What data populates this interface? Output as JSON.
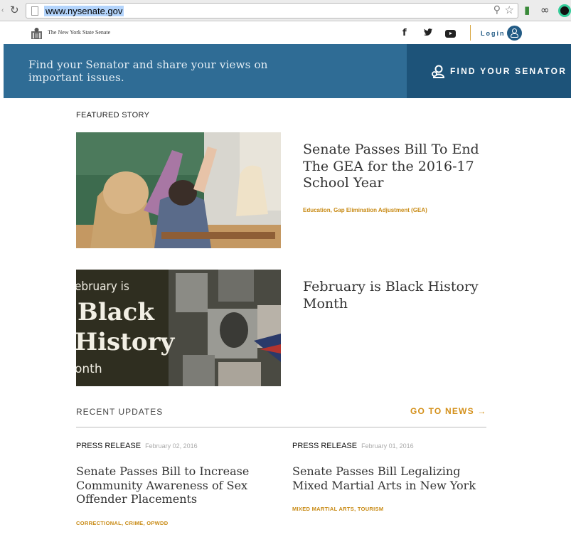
{
  "browser": {
    "url": "www.nysenate.gov",
    "icons": [
      "back-icon",
      "reload-icon",
      "page-icon",
      "zoom-icon",
      "bookmark-star-icon",
      "extension-icon",
      "extension-icon",
      "extension-icon"
    ]
  },
  "header": {
    "site_name": "The New York State Senate",
    "social": [
      "facebook-icon",
      "twitter-icon",
      "youtube-icon"
    ],
    "login_label": "Login"
  },
  "banner": {
    "text": "Find your Senator and share your views on important issues.",
    "button_label": "FIND YOUR SENATOR"
  },
  "featured": {
    "label": "FEATURED STORY",
    "stories": [
      {
        "title": "Senate Passes Bill To End The GEA for the 2016-17 School Year",
        "tags": "Education, Gap Elimination Adjustment (GEA)"
      },
      {
        "title": "February is Black History Month",
        "image_text": {
          "line1": "ebruary is",
          "line2": "Black",
          "line3": "History",
          "line4": "onth"
        }
      }
    ]
  },
  "recent": {
    "label": "RECENT UPDATES",
    "go_to_news": "GO TO NEWS",
    "go_to_news_arrow": "→",
    "items": [
      {
        "type": "PRESS RELEASE",
        "date": "February 02, 2016",
        "headline": "Senate Passes Bill to Increase Community Awareness of Sex Offender Placements",
        "tags": "CORRECTIONAL, CRIME, OPWDD"
      },
      {
        "type": "PRESS RELEASE",
        "date": "February 01, 2016",
        "headline": "Senate Passes Bill Legalizing Mixed Martial Arts in New York",
        "tags": "MIXED MARTIAL ARTS, TOURISM"
      }
    ]
  },
  "colors": {
    "banner": "#2f6c95",
    "banner_button": "#1d5379",
    "accent": "#d4901a",
    "brand_blue": "#225b85"
  }
}
